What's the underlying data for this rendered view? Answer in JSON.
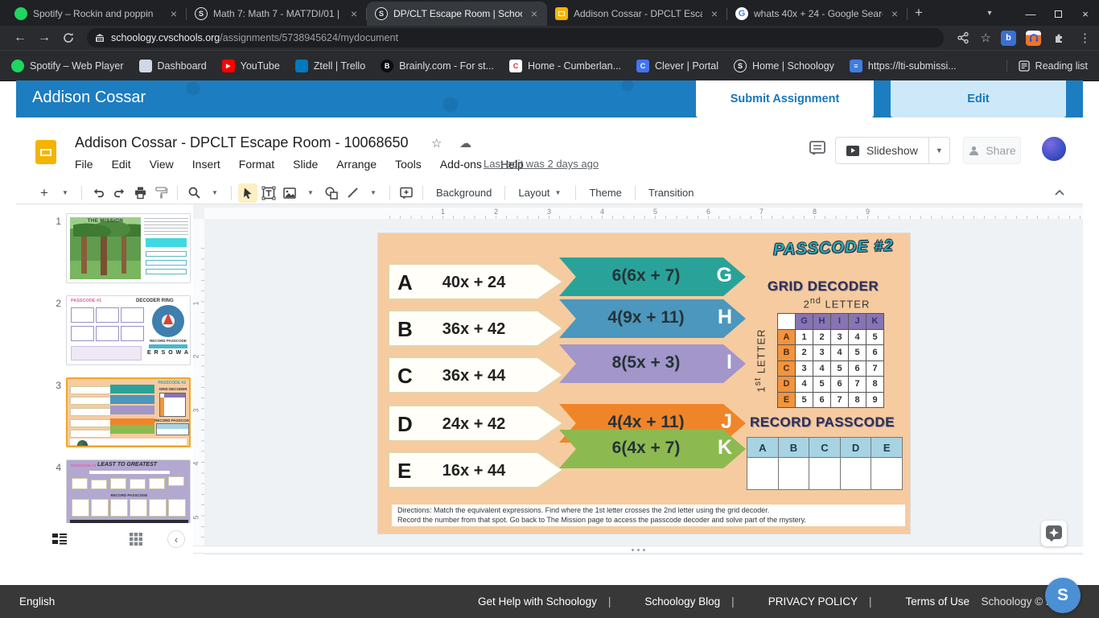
{
  "chrome": {
    "tabs": [
      {
        "title": "Spotify – Rockin and poppin",
        "icon": "spotify"
      },
      {
        "title": "Math 7: Math 7 - MAT7DI/01 |",
        "icon": "schoology"
      },
      {
        "title": "DP/CLT Escape Room | School",
        "icon": "schoology"
      },
      {
        "title": "Addison Cossar - DPCLT Escap",
        "icon": "slides"
      },
      {
        "title": "whats 40x + 24 - Google Searc",
        "icon": "google"
      }
    ],
    "schoology_glyph": "S",
    "google_glyph": "G",
    "close_glyph": "×",
    "url_domain": "schoology.cvschools.org",
    "url_path": "/assignments/5738945624/mydocument",
    "bookmarks": [
      {
        "label": "Spotify – Web Player",
        "glyph": "",
        "color": "#1ed760",
        "shape": "round"
      },
      {
        "label": "Dashboard",
        "glyph": "",
        "color": "#cfd8e6",
        "shape": "square"
      },
      {
        "label": "YouTube",
        "glyph": "▶",
        "color": "#f00",
        "shape": "square"
      },
      {
        "label": "Ztell | Trello",
        "glyph": "",
        "color": "#0079bf",
        "shape": "square"
      },
      {
        "label": "Brainly.com - For st...",
        "glyph": "B",
        "color": "#0b0b0f",
        "shape": "round"
      },
      {
        "label": "Home - Cumberlan...",
        "glyph": "C",
        "color": "#c33",
        "shape": "square"
      },
      {
        "label": "Clever | Portal",
        "glyph": "C",
        "color": "#4274f6",
        "shape": "square"
      },
      {
        "label": "Home | Schoology",
        "glyph": "S",
        "color": "#25272b",
        "shape": "round"
      },
      {
        "label": "https://lti-submissi...",
        "glyph": "≡",
        "color": "#3f7de0",
        "shape": "square"
      }
    ],
    "reading_list_label": "Reading list",
    "extension_bing": "b"
  },
  "schoology": {
    "student_name": "Addison Cossar",
    "submit_label": "Submit Assignment",
    "edit_label": "Edit"
  },
  "slides_app": {
    "doc_title": "Addison Cossar - DPCLT Escape Room - 10068650",
    "star_glyph": "☆",
    "cloud_glyph": "☁",
    "menus": [
      "File",
      "Edit",
      "View",
      "Insert",
      "Format",
      "Slide",
      "Arrange",
      "Tools",
      "Add-ons",
      "Help"
    ],
    "last_edit": "Last edit was 2 days ago",
    "slideshow_label": "Slideshow",
    "share_label": "Share",
    "toolbar": {
      "background": "Background",
      "layout": "Layout",
      "theme": "Theme",
      "transition": "Transition"
    }
  },
  "filmstrip": {
    "slides": [
      {
        "number": "1",
        "title": "THE MISSION"
      },
      {
        "number": "2",
        "passcode": "PASSCODE #1",
        "title": "DECODER RING",
        "record": "RECORD PASSCODE",
        "letters": "E R S O W A"
      },
      {
        "number": "3"
      },
      {
        "number": "4",
        "passcode": "PASSCODE #3",
        "title": "LEAST TO GREATEST",
        "record": "RECORD PASSCODE"
      }
    ]
  },
  "slide": {
    "passcode_title": "PASSCODE  #2",
    "grid_title": "GRID DECODER",
    "second_letter": {
      "num": "2",
      "sup": "nd",
      "rest": " LETTER"
    },
    "first_letter": {
      "num": "1",
      "sup": "st",
      "rest": " LETTER"
    },
    "rows": [
      {
        "letter": "A",
        "expr": "40x + 24",
        "factored": "6(6x + 7)",
        "code": "G",
        "color": "#29a399"
      },
      {
        "letter": "B",
        "expr": "36x + 42",
        "factored": "4(9x + 11)",
        "code": "H",
        "color": "#4b97bd"
      },
      {
        "letter": "C",
        "expr": "36x + 44",
        "factored": "8(5x + 3)",
        "code": "I",
        "color": "#a296ca"
      },
      {
        "letter": "D",
        "expr": "24x + 42",
        "factored": "4(4x + 11)",
        "code": "J",
        "color": "#ef8528"
      },
      {
        "letter": "E",
        "expr": "16x + 44",
        "factored": "6(4x + 7)",
        "code": "K",
        "color": "#8cba50"
      }
    ],
    "grid": {
      "header": [
        "G",
        "H",
        "I",
        "J",
        "K"
      ],
      "rows": [
        {
          "label": "A",
          "values": [
            "1",
            "2",
            "3",
            "4",
            "5"
          ]
        },
        {
          "label": "B",
          "values": [
            "2",
            "3",
            "4",
            "5",
            "6"
          ]
        },
        {
          "label": "C",
          "values": [
            "3",
            "4",
            "5",
            "6",
            "7"
          ]
        },
        {
          "label": "D",
          "values": [
            "4",
            "5",
            "6",
            "7",
            "8"
          ]
        },
        {
          "label": "E",
          "values": [
            "5",
            "6",
            "7",
            "8",
            "9"
          ]
        }
      ]
    },
    "record_title": "RECORD  PASSCODE",
    "record_header": [
      "A",
      "B",
      "C",
      "D",
      "E"
    ],
    "directions_line1": "Directions: Match the equivalent expressions.  Find where the 1st letter crosses the 2nd letter using the grid decoder.",
    "directions_line2": "Record the number from that spot.  Go back to The Mission page to access the passcode decoder and solve part of the mystery.",
    "background_color": "#f7cba0"
  },
  "rulers": {
    "horizontal": [
      "1",
      "2",
      "3",
      "4",
      "5",
      "6",
      "7",
      "8",
      "9"
    ],
    "vertical": [
      "1",
      "2",
      "3",
      "4",
      "5"
    ]
  },
  "footer": {
    "language": "English",
    "links": [
      "Get Help with Schoology",
      "Schoology Blog",
      "PRIVACY POLICY",
      "Terms of Use"
    ],
    "copyright": "Schoology © 2022",
    "logo_letter": "S"
  },
  "colors": {
    "schoology_blue": "#1c7dc0",
    "selected_thumb_border": "#f0a62f",
    "grid_header_purple": "#8774b2",
    "grid_label_orange": "#f2943e",
    "record_header_blue": "#a6d4e5"
  }
}
